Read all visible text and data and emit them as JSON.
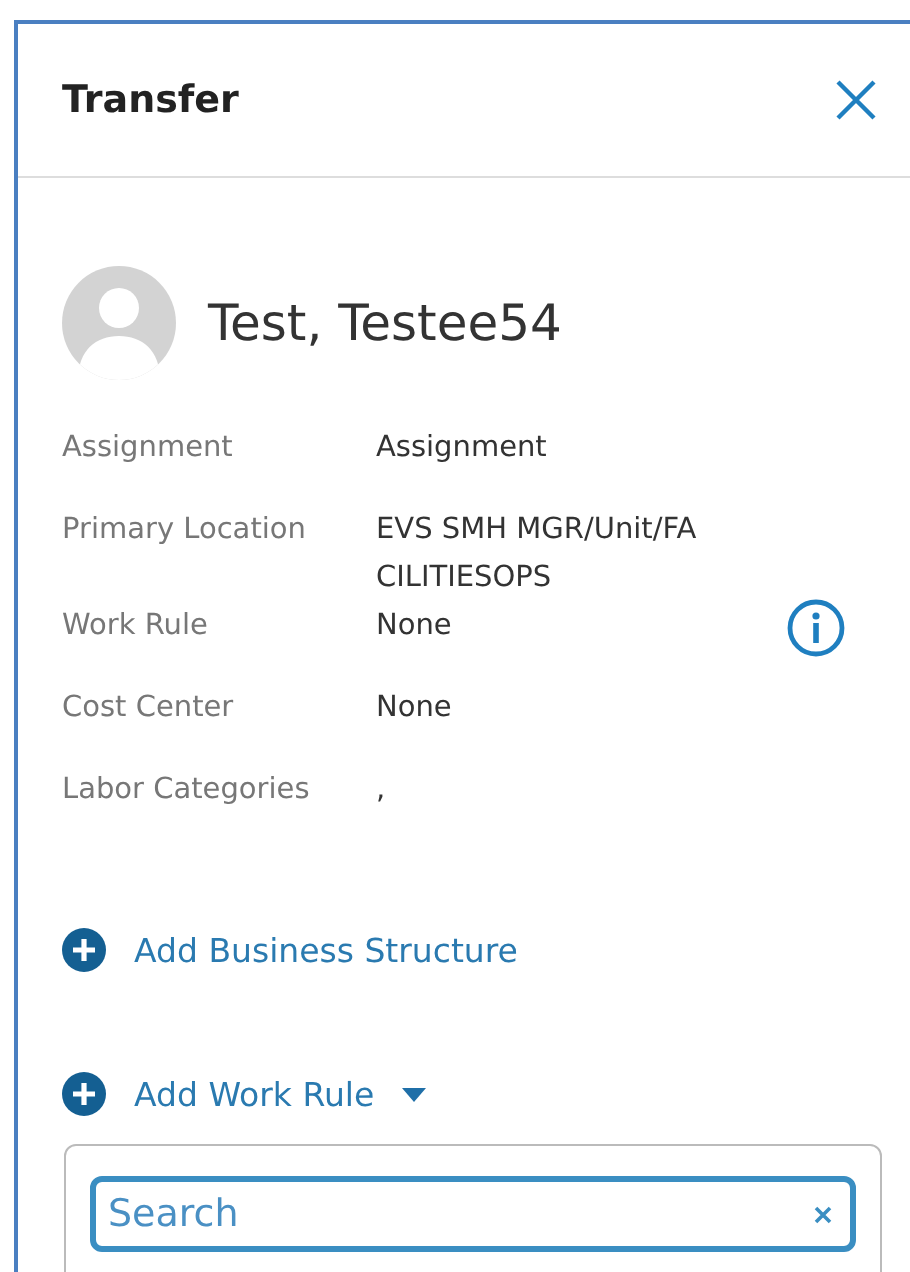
{
  "panel": {
    "title": "Transfer"
  },
  "person": {
    "name": "Test, Testee54"
  },
  "fields": [
    {
      "label": "Assignment",
      "value": "Assignment",
      "info": false
    },
    {
      "label": "Primary Location",
      "value": "EVS SMH MGR/Unit/FA CILITIESOPS",
      "info": false
    },
    {
      "label": "Work Rule",
      "value": "None",
      "info": true
    },
    {
      "label": "Cost Center",
      "value": "None",
      "info": false
    },
    {
      "label": "Labor Categories",
      "value": ",",
      "info": false
    }
  ],
  "actions": [
    {
      "label": "Add Business Structure",
      "dropdown": false
    },
    {
      "label": "Add Work Rule",
      "dropdown": true
    }
  ],
  "search": {
    "placeholder": "Search"
  }
}
